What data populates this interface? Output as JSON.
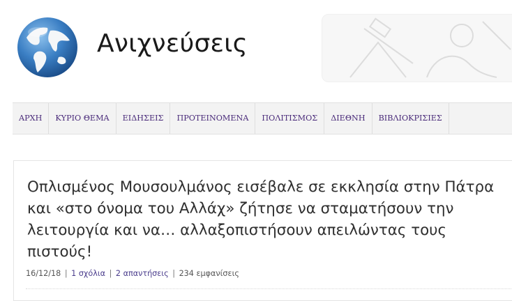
{
  "site": {
    "title": "Ανιχνεύσεις"
  },
  "nav": {
    "items": [
      "ΑΡΧΗ",
      "ΚΥΡΙΟ ΘΕΜΑ",
      "ΕΙΔΗΣΕΙΣ",
      "ΠΡΟΤΕΙΝΟΜΕΝΑ",
      "ΠΟΛΙΤΙΣΜΟΣ",
      "ΔΙΕΘΝΗ",
      "ΒΙΒΛΙΟΚΡΙΣΙΕΣ"
    ]
  },
  "post": {
    "title": "Οπλισμένος Μουσουλμάνος εισέβαλε σε εκκλησία στην Πάτρα και «στο όνομα του Αλλάχ» ζήτησε να σταματήσουν την λειτουργία και να… αλλαξοπιστήσουν απειλώντας τους πιστούς!",
    "date": "16/12/18",
    "comments": "1 σχόλια",
    "replies": "2 απαντήσεις",
    "views": "234 εμφανίσεις",
    "separator": "|"
  },
  "icons": {
    "logo": "globe-icon",
    "banner": "telescope-icon"
  },
  "colors": {
    "nav_text": "#4a2b7a",
    "meta_link": "#4a3c8c",
    "globe_ocean": "#3b7fc4",
    "globe_land": "#ffffff"
  }
}
